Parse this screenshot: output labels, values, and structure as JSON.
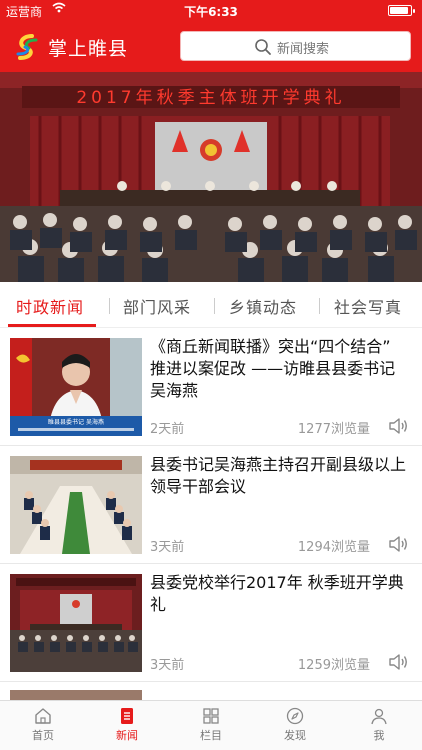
{
  "status_bar": {
    "carrier": "运营商",
    "time": "下午6:33",
    "battery_level": 0.9
  },
  "header": {
    "app_title": "掌上睢县",
    "search_placeholder": "新闻搜索",
    "brand_color": "#e61b1b"
  },
  "banner": {
    "caption": "2017年秋季主体班开学典礼",
    "slide_count": 10,
    "active_slide": 2
  },
  "tabs": [
    {
      "label": "时政新闻",
      "active": true
    },
    {
      "label": "部门风采",
      "active": false
    },
    {
      "label": "乡镇动态",
      "active": false
    },
    {
      "label": "社会写真",
      "active": false
    }
  ],
  "news": [
    {
      "title": "《商丘新闻联播》突出“四个结合” 推进以案促改 ——访睢县县委书记吴海燕",
      "time": "2天前",
      "views": "1277浏览量",
      "thumb_caption": "睢县县委书记 吴海燕"
    },
    {
      "title": "县委书记吴海燕主持召开副县级以上领导干部会议",
      "time": "3天前",
      "views": "1294浏览量"
    },
    {
      "title": "县委党校举行2017年 秋季班开学典礼",
      "time": "3天前",
      "views": "1259浏览量"
    }
  ],
  "bottom_nav": [
    {
      "label": "首页",
      "icon": "home-icon",
      "active": false
    },
    {
      "label": "新闻",
      "icon": "news-icon",
      "active": true
    },
    {
      "label": "栏目",
      "icon": "grid-icon",
      "active": false
    },
    {
      "label": "发现",
      "icon": "compass-icon",
      "active": false
    },
    {
      "label": "我",
      "icon": "user-icon",
      "active": false
    }
  ]
}
